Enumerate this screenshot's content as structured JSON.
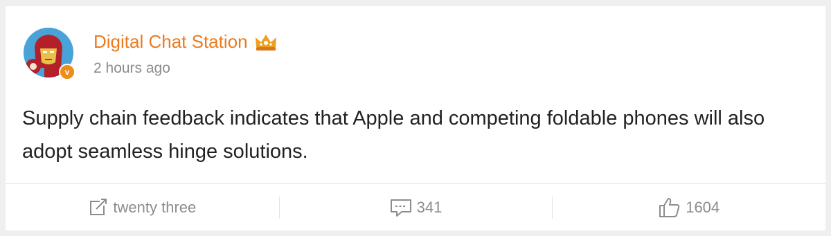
{
  "post": {
    "username": "Digital Chat Station",
    "timestamp": "2 hours ago",
    "verified_mark": "v",
    "text": "Supply chain feedback indicates that Apple and competing foldable phones will also adopt seamless hinge solutions.",
    "colors": {
      "username": "#eb7a1e",
      "verified_badge": "#f08c18",
      "crown": "#f0a020"
    }
  },
  "actions": {
    "repost_label": "twenty three",
    "comments_label": "341",
    "likes_label": "1604",
    "icons": [
      "repost-icon",
      "comment-icon",
      "like-icon"
    ]
  }
}
